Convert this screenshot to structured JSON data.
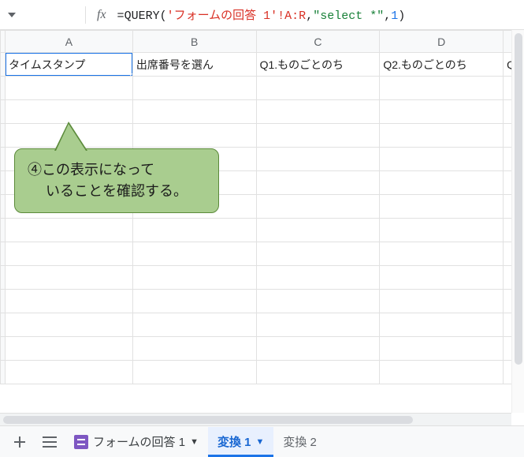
{
  "formula": {
    "prefix_eq": "=",
    "func": "QUERY",
    "open": "(",
    "arg1a": "'",
    "arg1b": "フォームの回答 1",
    "arg1c": "'!A:R",
    "comma1": ",",
    "arg2": "\"select *\"",
    "comma2": ",",
    "arg3": "1",
    "close": ")"
  },
  "columns": {
    "A": "A",
    "B": "B",
    "C": "C",
    "D": "D",
    "E": ""
  },
  "row1": {
    "A": "タイムスタンプ",
    "B": "出席番号を選ん",
    "C": "Q1.ものごとのち",
    "D": "Q2.ものごとのち",
    "E": "Q"
  },
  "callout": {
    "line1": "④この表示になって",
    "line2": "　 いることを確認する。"
  },
  "tabs": {
    "form": "フォームの回答 1",
    "active": "変換 1",
    "other": "変換 2"
  }
}
